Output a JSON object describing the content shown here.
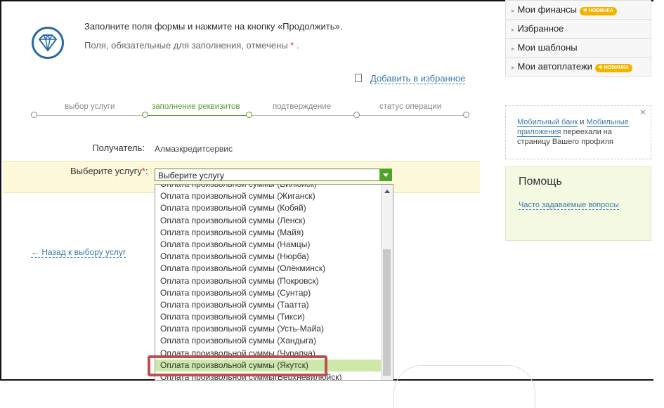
{
  "intro": {
    "line1": "Заполните поля формы и нажмите на кнопку «Продолжить».",
    "line2": "Поля, обязательные для заполнения, отмечены",
    "req_mark": "*",
    "line2_end": "."
  },
  "favorites": {
    "label": "Добавить в избранное"
  },
  "steps": [
    "выбор услуги",
    "заполнение реквизитов",
    "подтверждение",
    "статус операции"
  ],
  "recipient": {
    "label": "Получатель:",
    "value": "Алмазкредитсервис"
  },
  "service": {
    "label": "Выберите услугу",
    "req_mark": "*",
    "colon": ":",
    "selected": "Выберите услугу",
    "options": [
      "Оплата произвольной суммы (Вилюйск)",
      "Оплата произвольной суммы (Жиганск)",
      "Оплата произвольной суммы (Кобяй)",
      "Оплата произвольной суммы (Ленск)",
      "Оплата произвольной суммы (Майя)",
      "Оплата произвольной суммы (Намцы)",
      "Оплата произвольной суммы (Нюрба)",
      "Оплата произвольной суммы (Олёкминск)",
      "Оплата произвольной суммы (Покровск)",
      "Оплата произвольной суммы (Сунтар)",
      "Оплата произвольной суммы (Таатта)",
      "Оплата произвольной суммы (Тикси)",
      "Оплата произвольной суммы (Усть-Майа)",
      "Оплата произвольной суммы (Хандыга)",
      "Оплата произвольной суммы (Чурапча)",
      "Оплата произвольной суммы (Якутск)",
      "Оплата произвольной суммы(Верхневилюйск)"
    ],
    "highlighted_index": 15
  },
  "back_link": "← Назад к выбору услуг",
  "menu": [
    {
      "label": "Мои финансы",
      "badge": "НОВИНКА"
    },
    {
      "label": "Избранное"
    },
    {
      "label": "Мои шаблоны"
    },
    {
      "label": "Мои автоплатежи",
      "badge": "НОВИНКА"
    }
  ],
  "notice": {
    "link1": "Мобильный банк",
    "and": "и",
    "link2": "Мобильные приложения",
    "rest": "переехали на страницу Вашего профиля"
  },
  "help": {
    "title": "Помощь",
    "faq": "Часто задаваемые вопросы"
  },
  "colors": {
    "accent_green": "#4fa52c",
    "link_blue": "#3a7ab0",
    "badge_orange": "#f3b400",
    "highlight_red": "#c0504d"
  }
}
